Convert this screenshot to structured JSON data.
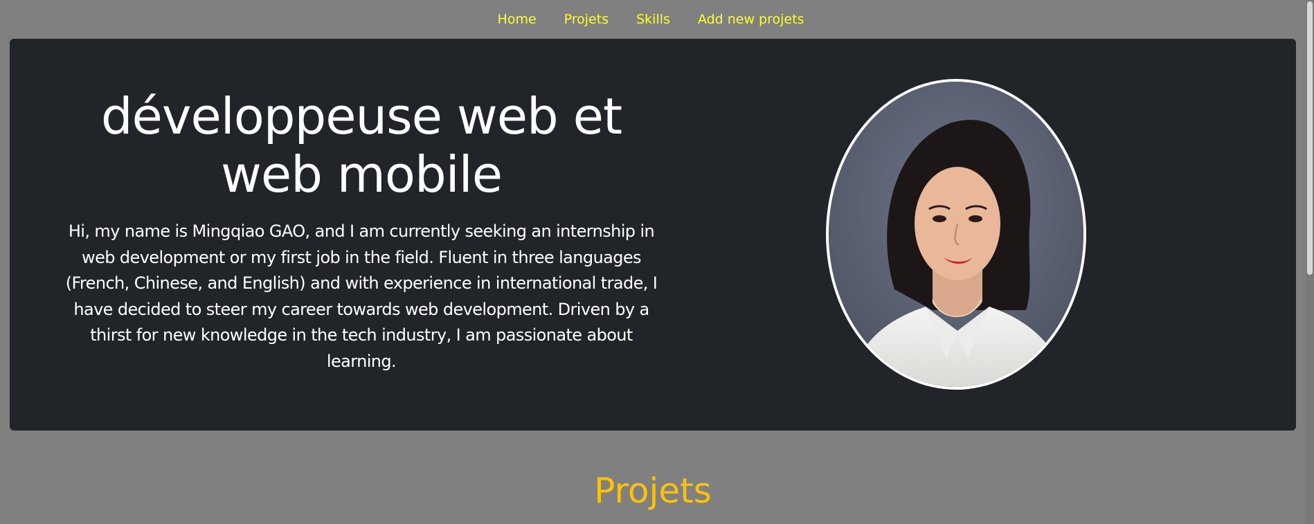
{
  "nav": {
    "items": [
      {
        "label": "Home"
      },
      {
        "label": "Projets"
      },
      {
        "label": "Skills"
      },
      {
        "label": "Add new projets"
      }
    ]
  },
  "hero": {
    "title": "développeuse web et web mobile",
    "description": "Hi, my name is Mingqiao GAO, and I am currently seeking an internship in web development or my first job in the field. Fluent in three languages (French, Chinese, and English) and with experience in international trade, I have decided to steer my career towards web development. Driven by a thirst for new knowledge in the tech industry, I am passionate about learning."
  },
  "section": {
    "title": "Projets"
  },
  "colors": {
    "page_background": "#808080",
    "hero_background": "#212529",
    "nav_link": "#ffff33",
    "section_title": "#ffc107"
  }
}
